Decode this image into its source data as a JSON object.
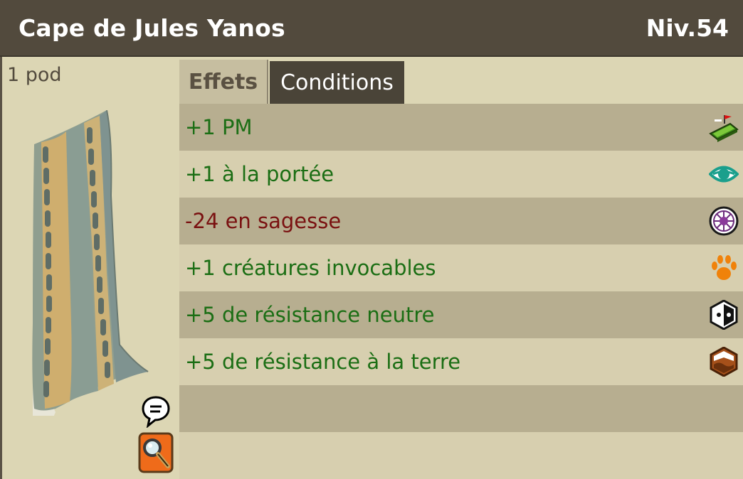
{
  "header": {
    "item_name": "Cape de Jules Yanos",
    "level": "Niv.54"
  },
  "left": {
    "weight": "1 pod"
  },
  "tabs": [
    {
      "label": "Effets",
      "active": true
    },
    {
      "label": "Conditions",
      "active": false
    }
  ],
  "effects": [
    {
      "text": "+1 PM",
      "type": "positive",
      "icon": "movement-points-icon"
    },
    {
      "text": "+1 à la portée",
      "type": "positive",
      "icon": "range-eye-icon"
    },
    {
      "text": "-24 en sagesse",
      "type": "negative",
      "icon": "wisdom-icon"
    },
    {
      "text": "+1 créatures invocables",
      "type": "positive",
      "icon": "summon-paw-icon"
    },
    {
      "text": "+5 de résistance neutre",
      "type": "positive",
      "icon": "neutral-resistance-icon"
    },
    {
      "text": "+5 de résistance à la terre",
      "type": "positive",
      "icon": "earth-resistance-icon"
    }
  ],
  "colors": {
    "positive": "#1b6e14",
    "negative": "#7a1111",
    "header_bg": "#524a3d"
  }
}
